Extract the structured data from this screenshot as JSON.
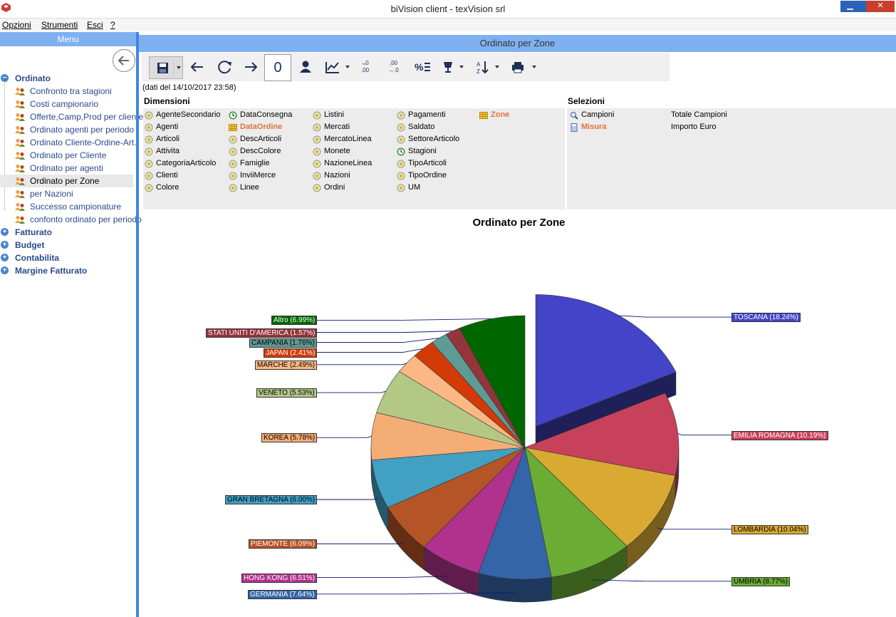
{
  "window": {
    "title": "biVision client - texVision srl"
  },
  "menubar": {
    "items": [
      "Opzioni",
      "Strumenti",
      "Esci",
      "?"
    ]
  },
  "left_panel": {
    "header": "Menu",
    "tree": [
      {
        "label": "Ordinato",
        "expanded": true,
        "children": [
          "Confronto tra stagioni",
          "Costi campionario",
          "Offerte,Camp,Prod per cliente",
          "Ordinato agenti per periodo",
          "Ordinato Cliente-Ordine-Art.",
          "Ordinato per Cliente",
          "Ordinato per agenti",
          "Ordinato per Zone",
          "per Nazioni",
          "Successo campionature",
          "confonto ordinato per periodo"
        ]
      },
      {
        "label": "Fatturato",
        "expanded": false
      },
      {
        "label": "Budget",
        "expanded": false
      },
      {
        "label": "Contabilita",
        "expanded": false
      },
      {
        "label": "Margine Fatturato",
        "expanded": false
      }
    ],
    "selected": "Ordinato per Zone"
  },
  "main": {
    "header": "Ordinato per Zone",
    "counter_value": "0",
    "dates_text": "(dati del 14/10/2017 23:58)",
    "dimensions_title": "Dimensioni",
    "selections_title": "Selezioni",
    "dimensions": [
      [
        "AgenteSecondario",
        "Agenti",
        "Articoli",
        "Attivita",
        "CategoriaArticolo",
        "Clienti",
        "Colore"
      ],
      [
        "DataConsegna",
        "DataOrdine",
        "DescArticoli",
        "DescColore",
        "Famiglie",
        "InviiMerce",
        "Linee"
      ],
      [
        "Listini",
        "Mercati",
        "MercatoLinea",
        "Monete",
        "NazioneLinea",
        "Nazioni",
        "Ordini"
      ],
      [
        "Pagamenti",
        "Saldato",
        "SettoreArticolo",
        "Stagioni",
        "TipoArticoli",
        "TipoOrdine",
        "UM"
      ],
      [
        "Zone"
      ]
    ],
    "active_dimensions": [
      "DataOrdine",
      "Zone"
    ],
    "selections": [
      {
        "name": "Campioni",
        "value": "Totale Campioni",
        "active": false
      },
      {
        "name": "Misura",
        "value": "Importo Euro",
        "active": true
      }
    ]
  },
  "chart_data": {
    "type": "pie",
    "title": "Ordinato per Zone",
    "slices": [
      {
        "label": "TOSCANA",
        "value": 18.24,
        "text": "TOSCANA (18.24%)",
        "color": "#4444c8"
      },
      {
        "label": "EMILIA ROMAGNA",
        "value": 10.19,
        "text": "EMILIA ROMAGNA (10.19%)",
        "color": "#c8415a"
      },
      {
        "label": "LOMBARDIA",
        "value": 10.04,
        "text": "LOMBARDIA (10.04%)",
        "color": "#d9aa32"
      },
      {
        "label": "UMBRIA",
        "value": 8.77,
        "text": "UMBRIA (8.77%)",
        "color": "#6aac34"
      },
      {
        "label": "GERMANIA",
        "value": 7.64,
        "text": "GERMANIA (7.64%)",
        "color": "#3465a8"
      },
      {
        "label": "HONG KONG",
        "value": 6.51,
        "text": "HONG KONG (6.51%)",
        "color": "#b0328e"
      },
      {
        "label": "PIEMONTE",
        "value": 6.09,
        "text": "PIEMONTE (6.09%)",
        "color": "#b55426"
      },
      {
        "label": "GRAN BRETAGNA",
        "value": 6.0,
        "text": "GRAN BRETAGNA (6.00%)",
        "color": "#42a0c2"
      },
      {
        "label": "KOREA",
        "value": 5.78,
        "text": "KOREA (5.78%)",
        "color": "#f5ad76"
      },
      {
        "label": "VENETO",
        "value": 5.53,
        "text": "VENETO (5.53%)",
        "color": "#b4c886"
      },
      {
        "label": "MARCHE",
        "value": 2.49,
        "text": "MARCHE (2.49%)",
        "color": "#fbb884"
      },
      {
        "label": "JAPAN",
        "value": 2.41,
        "text": "JAPAN (2.41%)",
        "color": "#d43a08"
      },
      {
        "label": "CAMPANIA",
        "value": 1.76,
        "text": "CAMPANIA (1.76%)",
        "color": "#5e9a96"
      },
      {
        "label": "STATI UNITI D'AMERICA",
        "value": 1.57,
        "text": "STATI UNITI D'AMERICA (1.57%)",
        "color": "#93353a"
      },
      {
        "label": "Altro",
        "value": 6.99,
        "text": "Altro (6.99%)",
        "color": "#006600"
      }
    ],
    "exploded": "TOSCANA"
  }
}
